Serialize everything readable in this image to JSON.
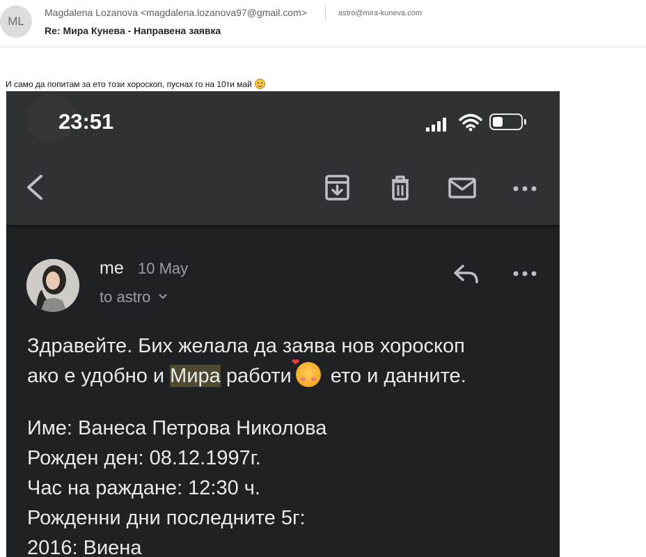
{
  "header": {
    "avatar_initials": "ML",
    "sender": "Magdalena Lozanova <magdalena.lozanova97@gmail.com>",
    "recipient": "astro@mira-kuneva.com",
    "subject": "Re: Мира Кунева - Направена заявка"
  },
  "body_text": "И само да попитам за ето този хороскоп, пуснах го на 10ти май",
  "phone": {
    "status_time": "23:51",
    "toolbar_icons": [
      "back-icon",
      "archive-icon",
      "trash-icon",
      "mail-icon",
      "more-icon"
    ],
    "message": {
      "sender": "me",
      "date": "10 May",
      "to": "to astro",
      "line1": "Здравейте. Бих желала да заява нов хороскоп",
      "line2_before": "ако е удобно и ",
      "line2_highlight": "Мира",
      "line2_after_word": " работи",
      "line2_end": " ето и данните.",
      "details": [
        "Име: Ванеса Петрова Николова",
        "Рожден ден: 08.12.1997г.",
        "Час на раждане: 12:30 ч.",
        "Рожденни дни последните 5г:",
        "2016: Виена"
      ]
    }
  },
  "colors": {
    "phone_bg": "#202124",
    "toolbar_bg": "#303134",
    "highlight": "#4e4a2f",
    "text_light": "#e8eaed",
    "text_muted": "#9aa0a6"
  }
}
